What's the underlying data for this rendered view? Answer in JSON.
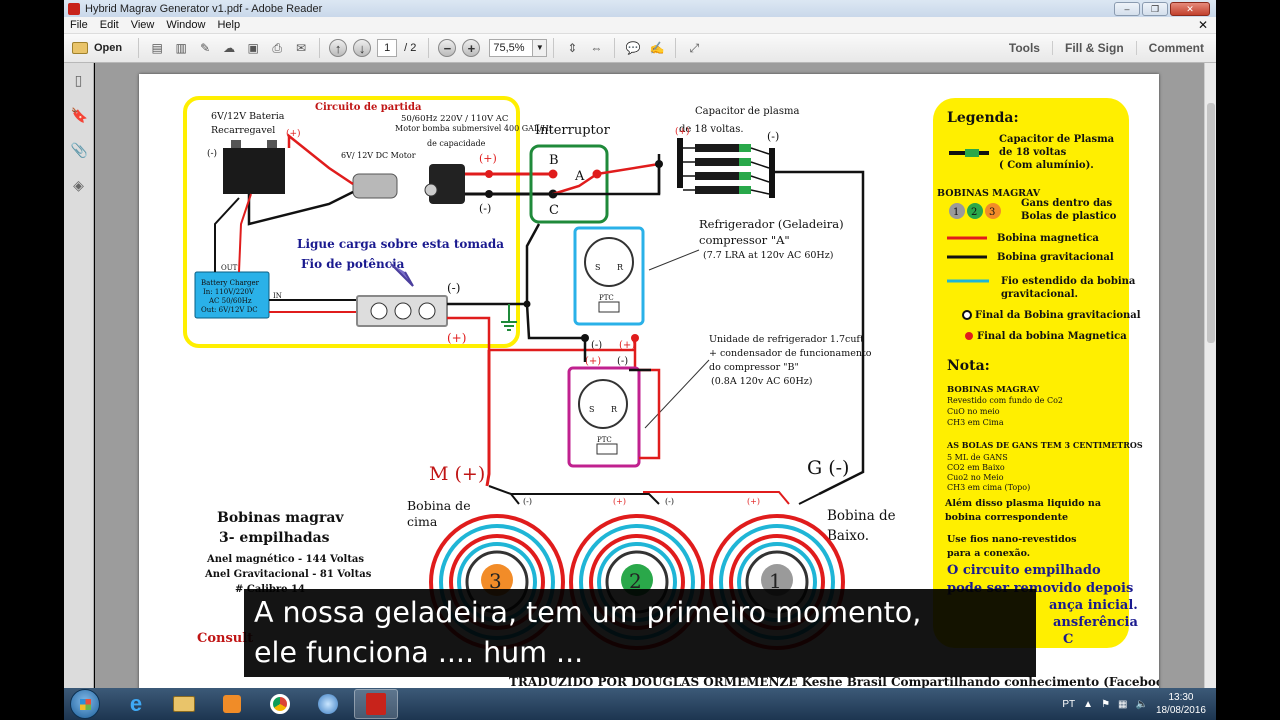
{
  "window": {
    "title": "Hybrid Magrav Generator v1.pdf - Adobe Reader"
  },
  "menu": [
    "File",
    "Edit",
    "View",
    "Window",
    "Help"
  ],
  "toolbar": {
    "open_label": "Open",
    "page_current": "1",
    "page_total": "/ 2",
    "zoom": "75,5%",
    "tools": "Tools",
    "fill_sign": "Fill & Sign",
    "comment": "Comment"
  },
  "diagram": {
    "battery_label_1": "6V/12V Bateria",
    "battery_label_2": "Recarregavel",
    "startup_circuit": "Circuito de partida",
    "pump_label_1": "50/60Hz 220V / 110V  AC",
    "pump_label_2": "Motor bomba submersivel 400 GAL/Hr",
    "pump_label_3": "de capacidade",
    "motor_label": "6V/ 12V DC Motor",
    "switch_label": "Interruptor",
    "plasma_label_1": "Capacitor de plasma",
    "plasma_label_2": "de 18 voltas.",
    "load_label": "Ligue carga sobre esta tomada",
    "power_wire": "Fio de potência",
    "charger_1": "Battery Charger",
    "charger_2": "In: 110V/220V",
    "charger_3": "AC 50/60Hz",
    "charger_4": "Out: 6V/12V DC",
    "out": "OUT",
    "in": "IN",
    "fridge_1": "Refrigerador (Geladeira)",
    "fridge_2": "compressor \"A\"",
    "fridge_3": "(7.7 LRA at 120v AC 60Hz)",
    "unit_1": "Unidade de refrigerador 1.7cuft",
    "unit_2": "+ condensador de funcionamento",
    "unit_3": "do compressor \"B\"",
    "unit_4": "(0.8A 120v AC 60Hz)",
    "m_plus": "M (+)",
    "g_minus": "G (-)",
    "coil_top": "Bobina de",
    "coil_top_2": "cima",
    "coil_bottom": "Bobina de",
    "coil_bottom_2": "Baixo.",
    "stacked_1": "Bobinas magrav",
    "stacked_2": "3- empilhadas",
    "stacked_3": "Anel magnético - 144 Voltas",
    "stacked_4": "Anel Gravitacional - 81 Voltas",
    "stacked_5": "# Calibre 14",
    "consult": "Consult",
    "ptc": "PTC",
    "plus": "(+)",
    "minus": "(-)",
    "A": "A",
    "B": "B",
    "C": "C",
    "S": "S",
    "R": "R",
    "coil_1": "1",
    "coil_2": "2",
    "coil_3": "3",
    "credit": "TRADUZIDO POR DOUGLAS ORMEMENZE Keshe Brasil Compartilhando conhecimento (Facebook)."
  },
  "legend": {
    "title": "Legenda:",
    "cap_1": "Capacitor de Plasma",
    "cap_2": "de 18 voltas",
    "cap_3": "( Com alumínio).",
    "coils_title": "BOBINAS MAGRAV",
    "gans_1": "Gans dentro das",
    "gans_2": "Bolas de plastico",
    "mag": "Bobina magnetica",
    "grav": "Bobina gravitacional",
    "ext_1": "Fio estendido da bobina",
    "ext_2": "gravitacional.",
    "end_grav": "Final da Bobina gravitacional",
    "end_mag": "Final da bobina Magnetica",
    "note": "Nota:",
    "n1": "BOBINAS MAGRAV",
    "n2": "Revestido com fundo de Co2",
    "n3": "CuO no meio",
    "n4": "CH3 em Cima",
    "n5": "AS BOLAS DE GANS TEM 3 CENTIMETROS",
    "n6": "5 ML de GANS",
    "n7": "CO2 em Baixo",
    "n8": "Cuo2 no Meio",
    "n9": "CH3 em cima (Topo)",
    "n10": "Além disso plasma liquido na",
    "n11": "bobina correspondente",
    "n12": "Use fios nano-revestidos",
    "n13": "para a conexão.",
    "n14": "O circuito empilhado",
    "n15": "pode ser removido depois",
    "n16": "ança inicial.",
    "n17": "ansferência",
    "n18": "C",
    "ball_1": "1",
    "ball_2": "2",
    "ball_3": "3"
  },
  "subtitle": {
    "line1": "A nossa geladeira, tem um primeiro momento,",
    "line2": "ele funciona .... hum ..."
  },
  "tray": {
    "lang": "PT",
    "time": "13:30",
    "date": "18/08/2016"
  },
  "colors": {
    "red": "#e01c1c",
    "black": "#111111",
    "cyan": "#1fb5d6",
    "yellow": "#ffef00",
    "green": "#1f8a3a",
    "magenta": "#c0218f"
  }
}
